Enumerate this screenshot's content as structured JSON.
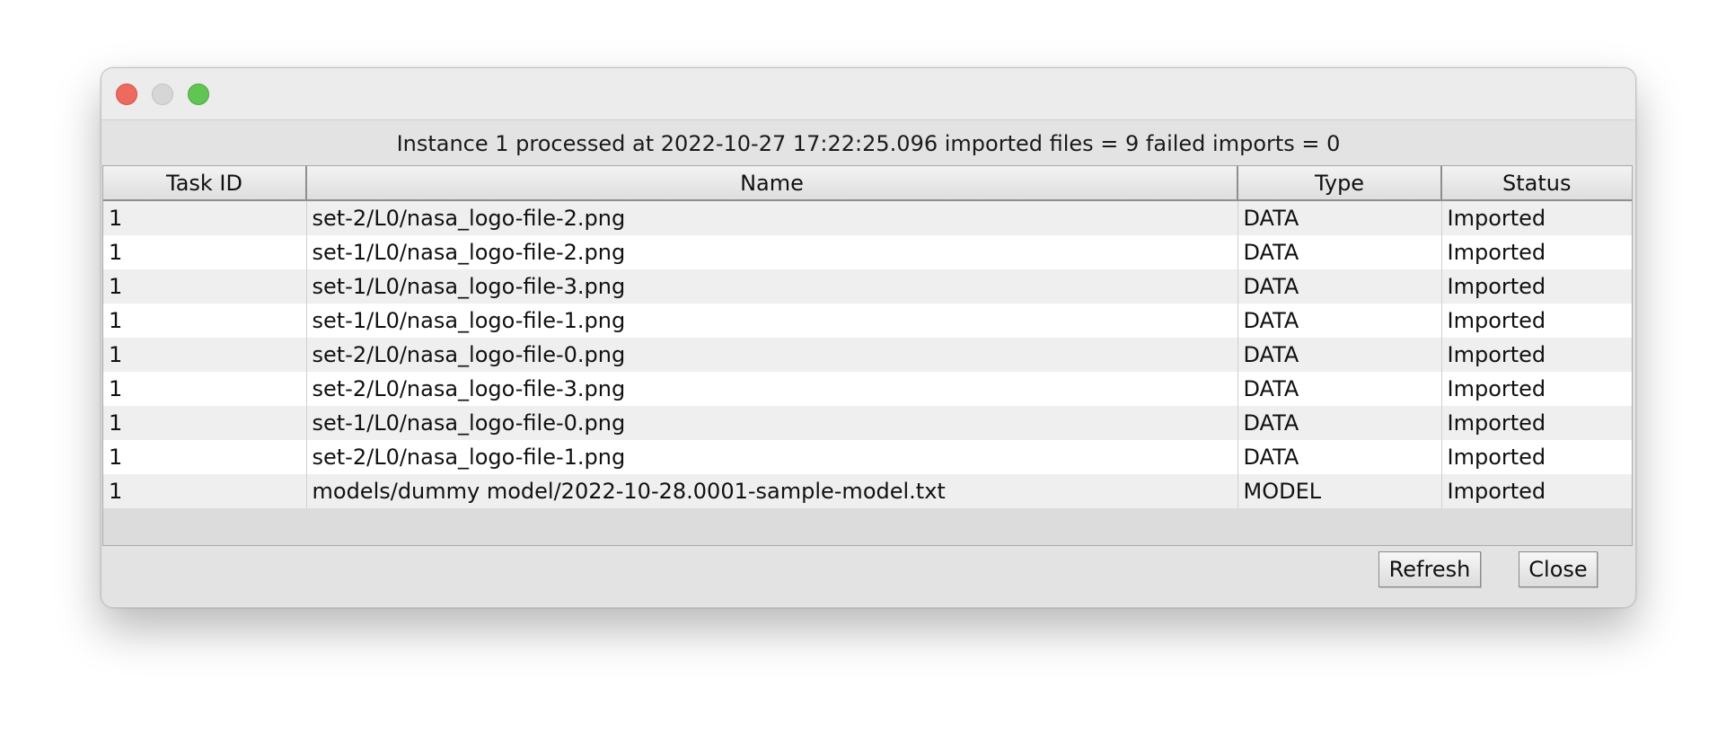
{
  "window": {
    "summary": "Instance 1 processed at 2022-10-27 17:22:25.096 imported files = 9 failed imports = 0"
  },
  "table": {
    "columns": [
      "Task ID",
      "Name",
      "Type",
      "Status"
    ],
    "rows": [
      {
        "task_id": "1",
        "name": "set-2/L0/nasa_logo-file-2.png",
        "type": "DATA",
        "status": "Imported"
      },
      {
        "task_id": "1",
        "name": "set-1/L0/nasa_logo-file-2.png",
        "type": "DATA",
        "status": "Imported"
      },
      {
        "task_id": "1",
        "name": "set-1/L0/nasa_logo-file-3.png",
        "type": "DATA",
        "status": "Imported"
      },
      {
        "task_id": "1",
        "name": "set-1/L0/nasa_logo-file-1.png",
        "type": "DATA",
        "status": "Imported"
      },
      {
        "task_id": "1",
        "name": "set-2/L0/nasa_logo-file-0.png",
        "type": "DATA",
        "status": "Imported"
      },
      {
        "task_id": "1",
        "name": "set-2/L0/nasa_logo-file-3.png",
        "type": "DATA",
        "status": "Imported"
      },
      {
        "task_id": "1",
        "name": "set-1/L0/nasa_logo-file-0.png",
        "type": "DATA",
        "status": "Imported"
      },
      {
        "task_id": "1",
        "name": "set-2/L0/nasa_logo-file-1.png",
        "type": "DATA",
        "status": "Imported"
      },
      {
        "task_id": "1",
        "name": "models/dummy model/2022-10-28.0001-sample-model.txt",
        "type": "MODEL",
        "status": "Imported"
      }
    ]
  },
  "buttons": {
    "refresh": "Refresh",
    "close": "Close"
  },
  "colors": {
    "close_light": "#ed6a5e",
    "minimize_light": "#d6d6d6",
    "maximize_light": "#61c554"
  }
}
